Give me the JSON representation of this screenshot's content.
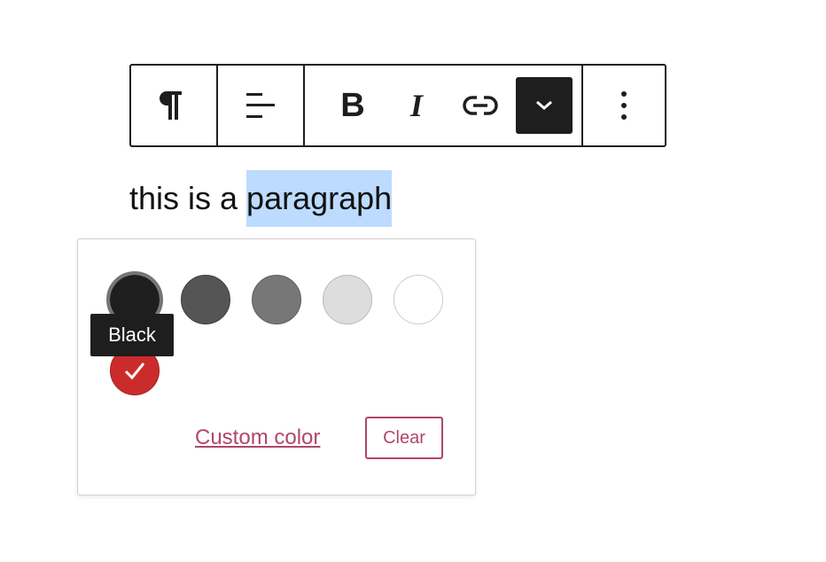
{
  "toolbar": {
    "block_type_icon": "paragraph-icon",
    "align_icon": "align-left-icon",
    "bold_label": "B",
    "italic_label": "I",
    "link_icon": "link-icon",
    "more_rich_text_icon": "chevron-down-icon",
    "options_icon": "more-vertical-icon"
  },
  "editor": {
    "text_before": "this is a ",
    "text_selected": "paragraph"
  },
  "color_picker": {
    "swatches": [
      {
        "name": "Black",
        "color": "#1e1e1e",
        "selected": false,
        "focused": true
      },
      {
        "name": "Dark gray",
        "color": "#555555",
        "selected": false
      },
      {
        "name": "Gray",
        "color": "#777777",
        "selected": false
      },
      {
        "name": "Light gray",
        "color": "#dddddd",
        "selected": false
      },
      {
        "name": "White",
        "color": "#ffffff",
        "selected": false
      },
      {
        "name": "Red",
        "color": "#cc2b2b",
        "selected": true
      }
    ],
    "tooltip": "Black",
    "custom_color_label": "Custom color",
    "clear_label": "Clear",
    "accent_color": "#b0466b"
  }
}
